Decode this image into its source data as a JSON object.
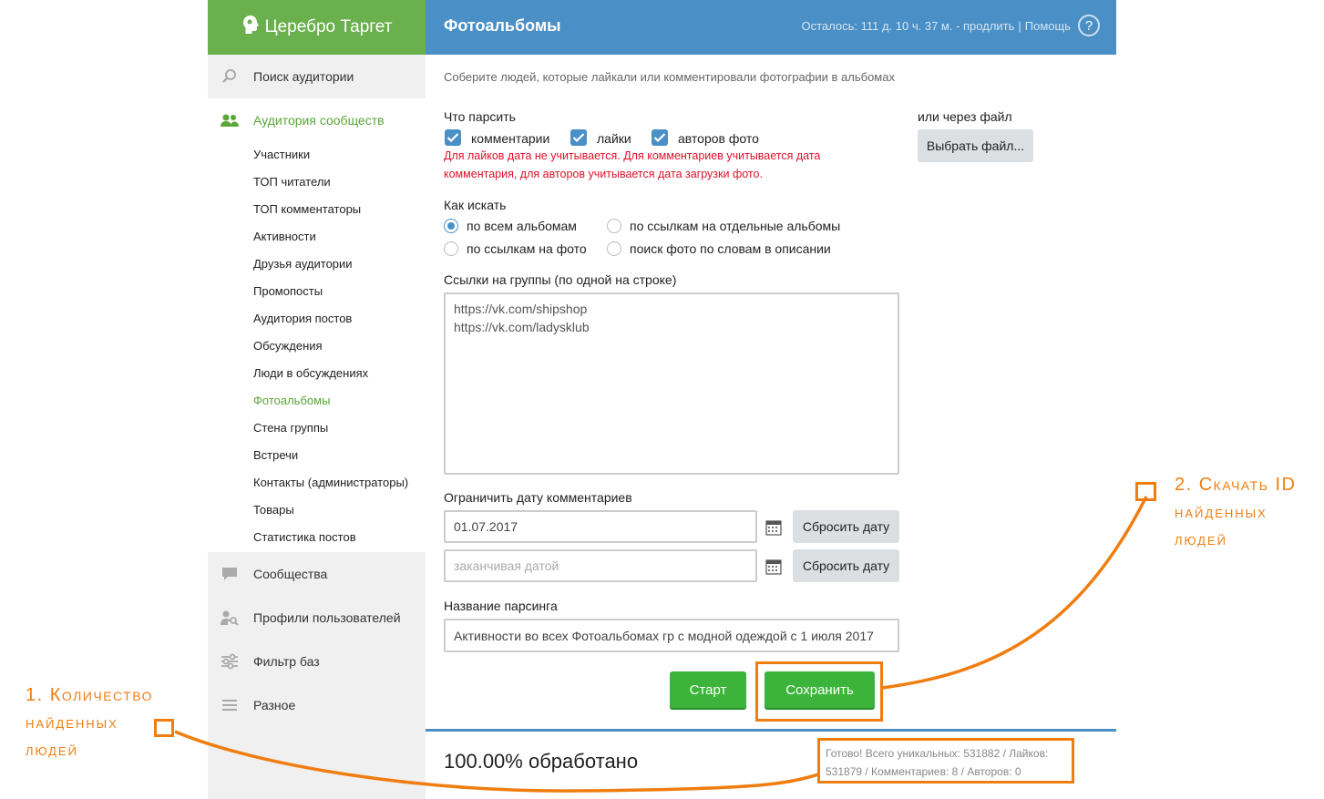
{
  "header": {
    "app_name": "Церебро Таргет",
    "page_title": "Фотоальбомы",
    "remaining": "Осталось: 111 д. 10 ч. 37 м. - продлить",
    "separator": "|",
    "help_link": "Помощь",
    "help_icon": "?"
  },
  "sidebar": {
    "sections": [
      {
        "label": "Поиск аудитории",
        "icon": "search-icon"
      },
      {
        "label": "Аудитория сообществ",
        "icon": "users-icon",
        "active": true
      },
      {
        "label": "Сообщества",
        "icon": "chat-icon"
      },
      {
        "label": "Профили пользователей",
        "icon": "profile-search-icon"
      },
      {
        "label": "Фильтр баз",
        "icon": "filter-sliders-icon"
      },
      {
        "label": "Разное",
        "icon": "menu-icon"
      }
    ],
    "sub_items": [
      "Участники",
      "ТОП читатели",
      "ТОП комментаторы",
      "Активности",
      "Друзья аудитории",
      "Промопосты",
      "Аудитория постов",
      "Обсуждения",
      "Люди в обсуждениях",
      "Фотоальбомы",
      "Стена группы",
      "Встречи",
      "Контакты (администраторы)",
      "Товары",
      "Статистика постов"
    ],
    "active_sub_index": 9
  },
  "main": {
    "description": "Соберите людей, которые лайкали или комментировали фотографии в альбомах",
    "what_to_parse": {
      "label": "Что парсить",
      "options": [
        {
          "label": "комментарии",
          "checked": true
        },
        {
          "label": "лайки",
          "checked": true
        },
        {
          "label": "авторов фото",
          "checked": true
        }
      ],
      "warning_line1": "Для лайков дата не учитывается. Для комментариев учитывается дата",
      "warning_line2": "комментария, для авторов учитывается дата загрузки фото."
    },
    "file": {
      "label": "или через файл",
      "button": "Выбрать файл..."
    },
    "how_to_search": {
      "label": "Как искать",
      "options": [
        {
          "label": "по всем альбомам",
          "selected": true
        },
        {
          "label": "по ссылкам на отдельные альбомы",
          "selected": false
        },
        {
          "label": "по ссылкам на фото",
          "selected": false
        },
        {
          "label": "поиск фото по словам в описании",
          "selected": false
        }
      ]
    },
    "groups": {
      "label": "Ссылки на группы (по одной на строке)",
      "value": "https://vk.com/shipshop\nhttps://vk.com/ladysklub"
    },
    "date_limit": {
      "label": "Ограничить дату комментариев",
      "from_value": "01.07.2017",
      "to_placeholder": "заканчивая датой",
      "reset_label": "Сбросить дату"
    },
    "parsing_name": {
      "label": "Название парсинга",
      "value": "Активности во всех Фотоальбомах гр с модной одеждой с 1 июля 2017"
    },
    "buttons": {
      "start": "Старт",
      "save": "Сохранить"
    },
    "status": {
      "progress_text": "100.00% обработано",
      "progress": 1.0,
      "result_line1": "Готово! Всего уникальных: 531882 / Лайков:",
      "result_line2": "531879 / Комментариев: 8 / Авторов: 0"
    }
  },
  "annotations": {
    "left": {
      "line1": "1. Количество",
      "line2": "найденных",
      "line3": "людей"
    },
    "right": {
      "line1": "2. Скачать ID",
      "line2": "найденных",
      "line3": "людей"
    },
    "color": "#f07d10"
  },
  "colors": {
    "brand_green": "#6ab04c",
    "header_blue": "#4a8fc5",
    "button_green": "#3cb43c",
    "warning_red": "#e0102a",
    "annotation_orange": "#f07d10"
  }
}
